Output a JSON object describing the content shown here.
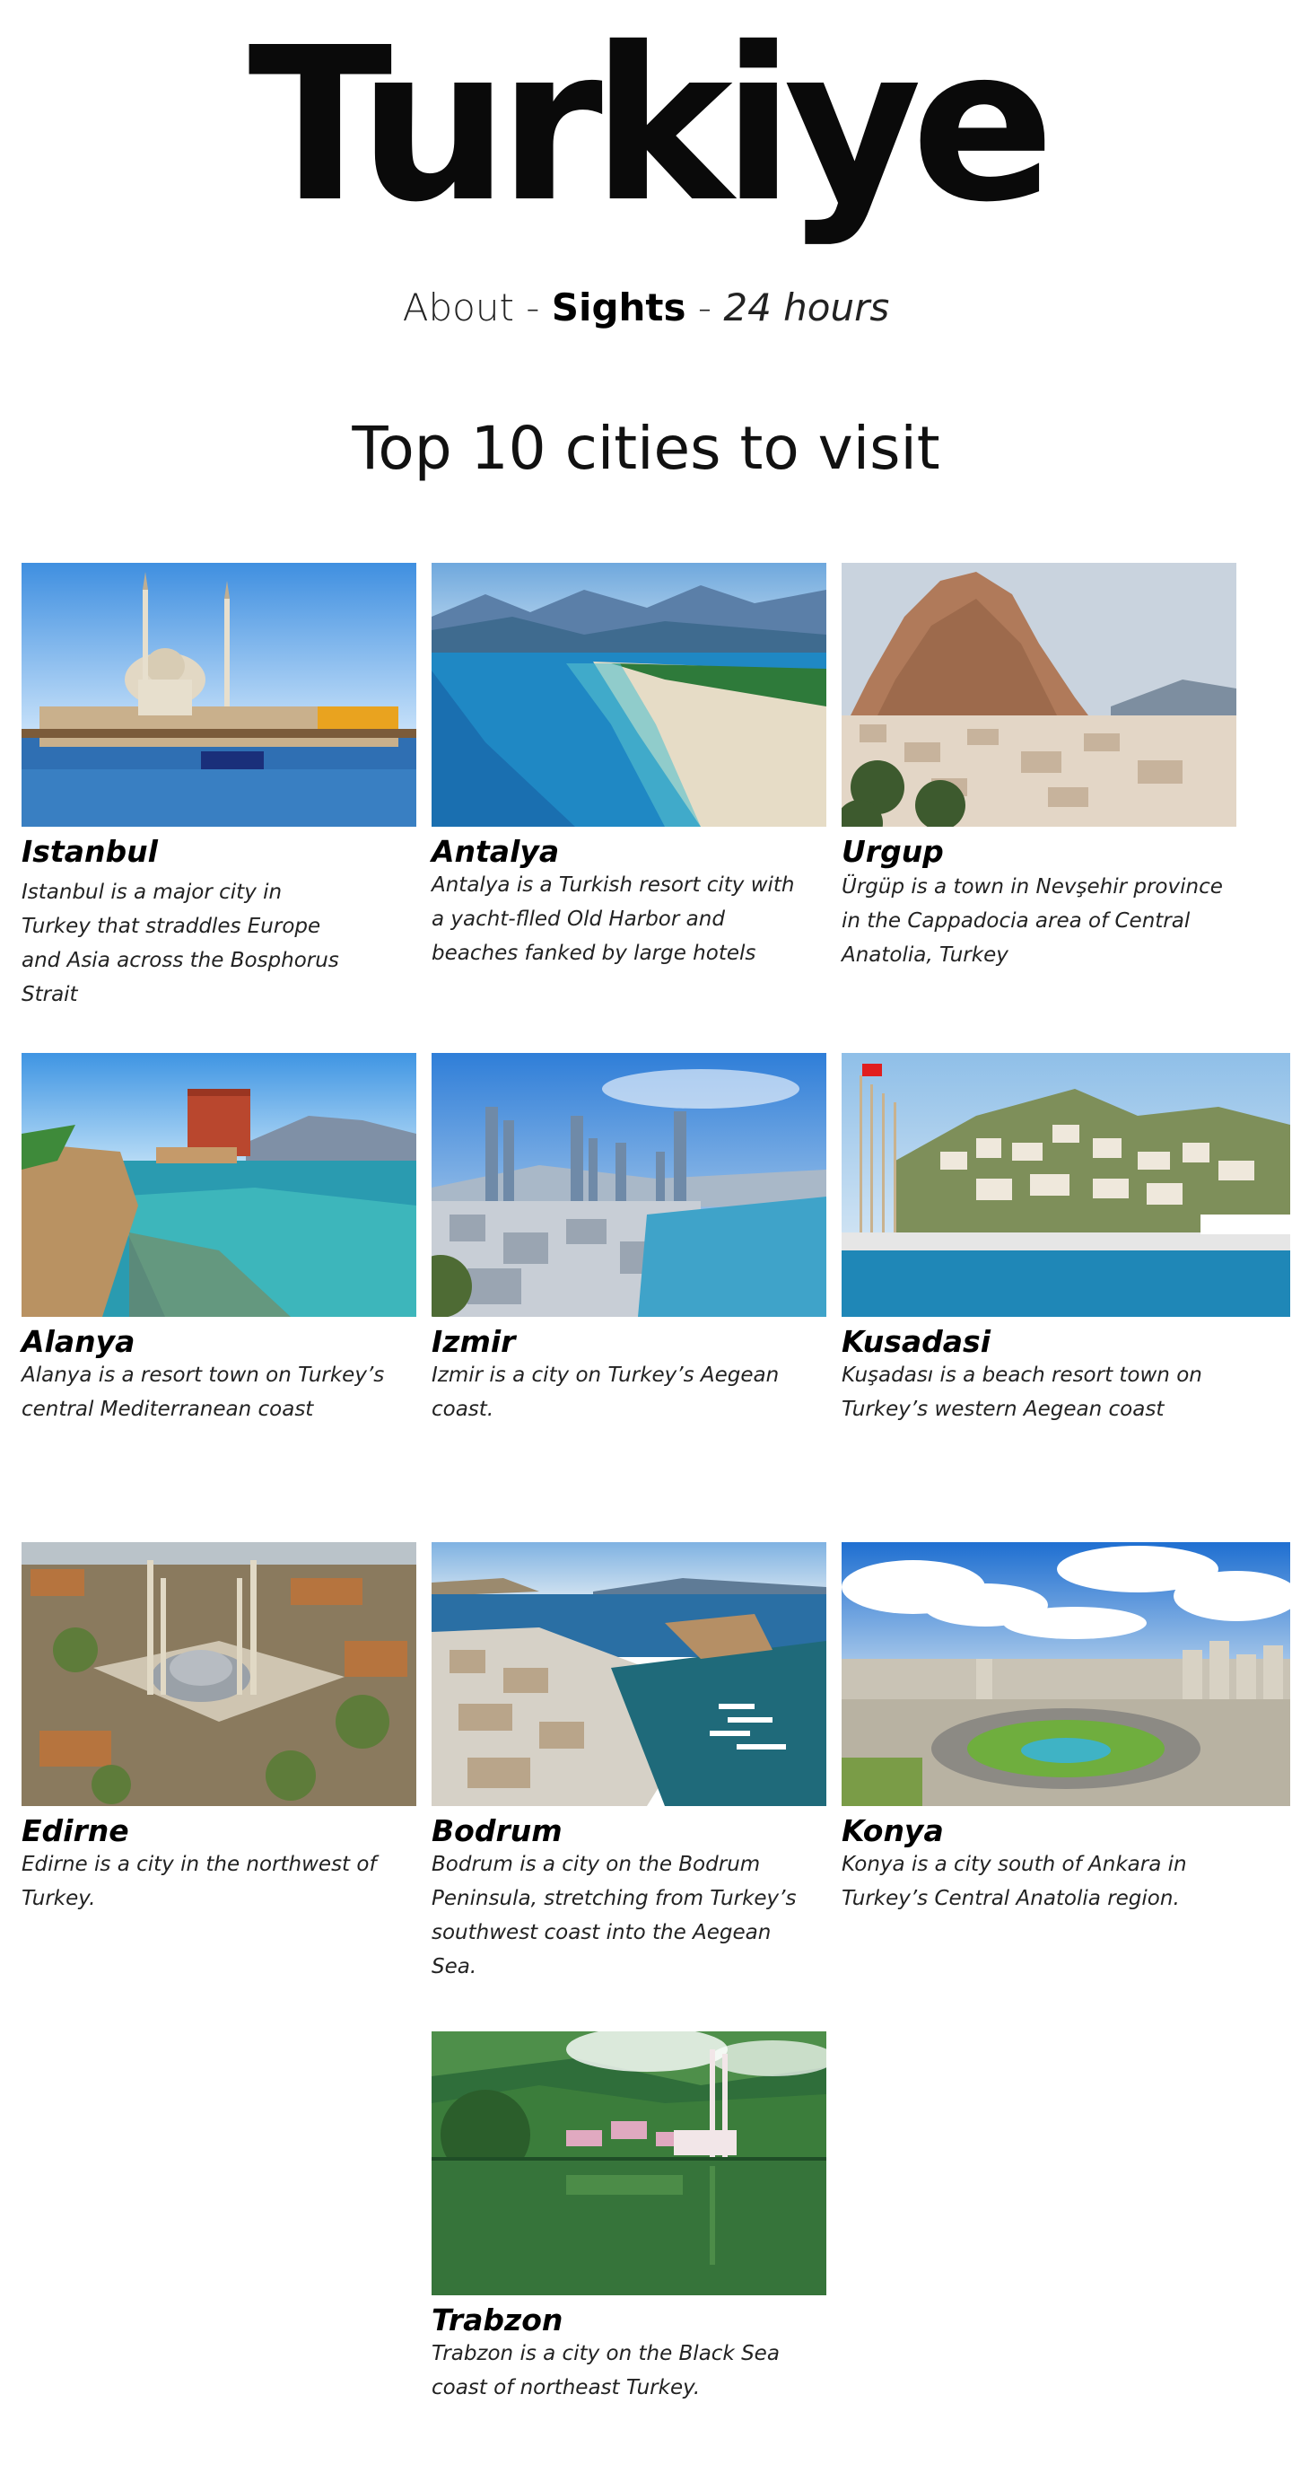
{
  "site": {
    "title": "Turkiye"
  },
  "nav": {
    "about": "About",
    "sep1": "-",
    "sights": "Sights",
    "sep2": "-",
    "hours": "24 hours"
  },
  "section": {
    "heading": "Top 10 cities to visit"
  },
  "cities": [
    {
      "name": "Istanbul",
      "description": "Istanbul is a major city in Turkey that straddles Europe and Asia across the Bosphorus Strait",
      "photo": "istanbul-mosque-waterfront"
    },
    {
      "name": "Antalya",
      "description": "Antalya is a Turkish resort city with a yacht-flled Old Harbor and beaches fanked by large hotels",
      "photo": "antalya-beach-coast"
    },
    {
      "name": "Urgup",
      "description": "Ürgüp is a town in Nevşehir province in the Cappadocia area of Central Anatolia, Turkey",
      "photo": "urgup-rock-castle"
    },
    {
      "name": "Alanya",
      "description": "Alanya is a resort town on Turkey’s central Mediterranean coast",
      "photo": "alanya-red-tower"
    },
    {
      "name": "Izmir",
      "description": "Izmir is a city on Turkey’s Aegean coast.",
      "photo": "izmir-skyline-bay"
    },
    {
      "name": "Kusadasi",
      "description": "Kuşadası is a beach resort town on Turkey’s western Aegean coast",
      "photo": "kusadasi-harbor-hill"
    },
    {
      "name": "Edirne",
      "description": "Edirne is a city in the northwest of Turkey.",
      "photo": "edirne-selimiye-mosque"
    },
    {
      "name": "Bodrum",
      "description": "Bodrum is a city on the Bodrum Peninsula, stretching from Turkey’s southwest coast into the Aegean Sea.",
      "photo": "bodrum-marina-castle"
    },
    {
      "name": "Konya",
      "description": "Konya is a city south of Ankara in Turkey’s Central Anatolia region.",
      "photo": "konya-roundabout-city"
    },
    {
      "name": "Trabzon",
      "description": "Trabzon is a city on the Black Sea coast of northeast Turkey.",
      "photo": "trabzon-lake-mosque"
    }
  ]
}
